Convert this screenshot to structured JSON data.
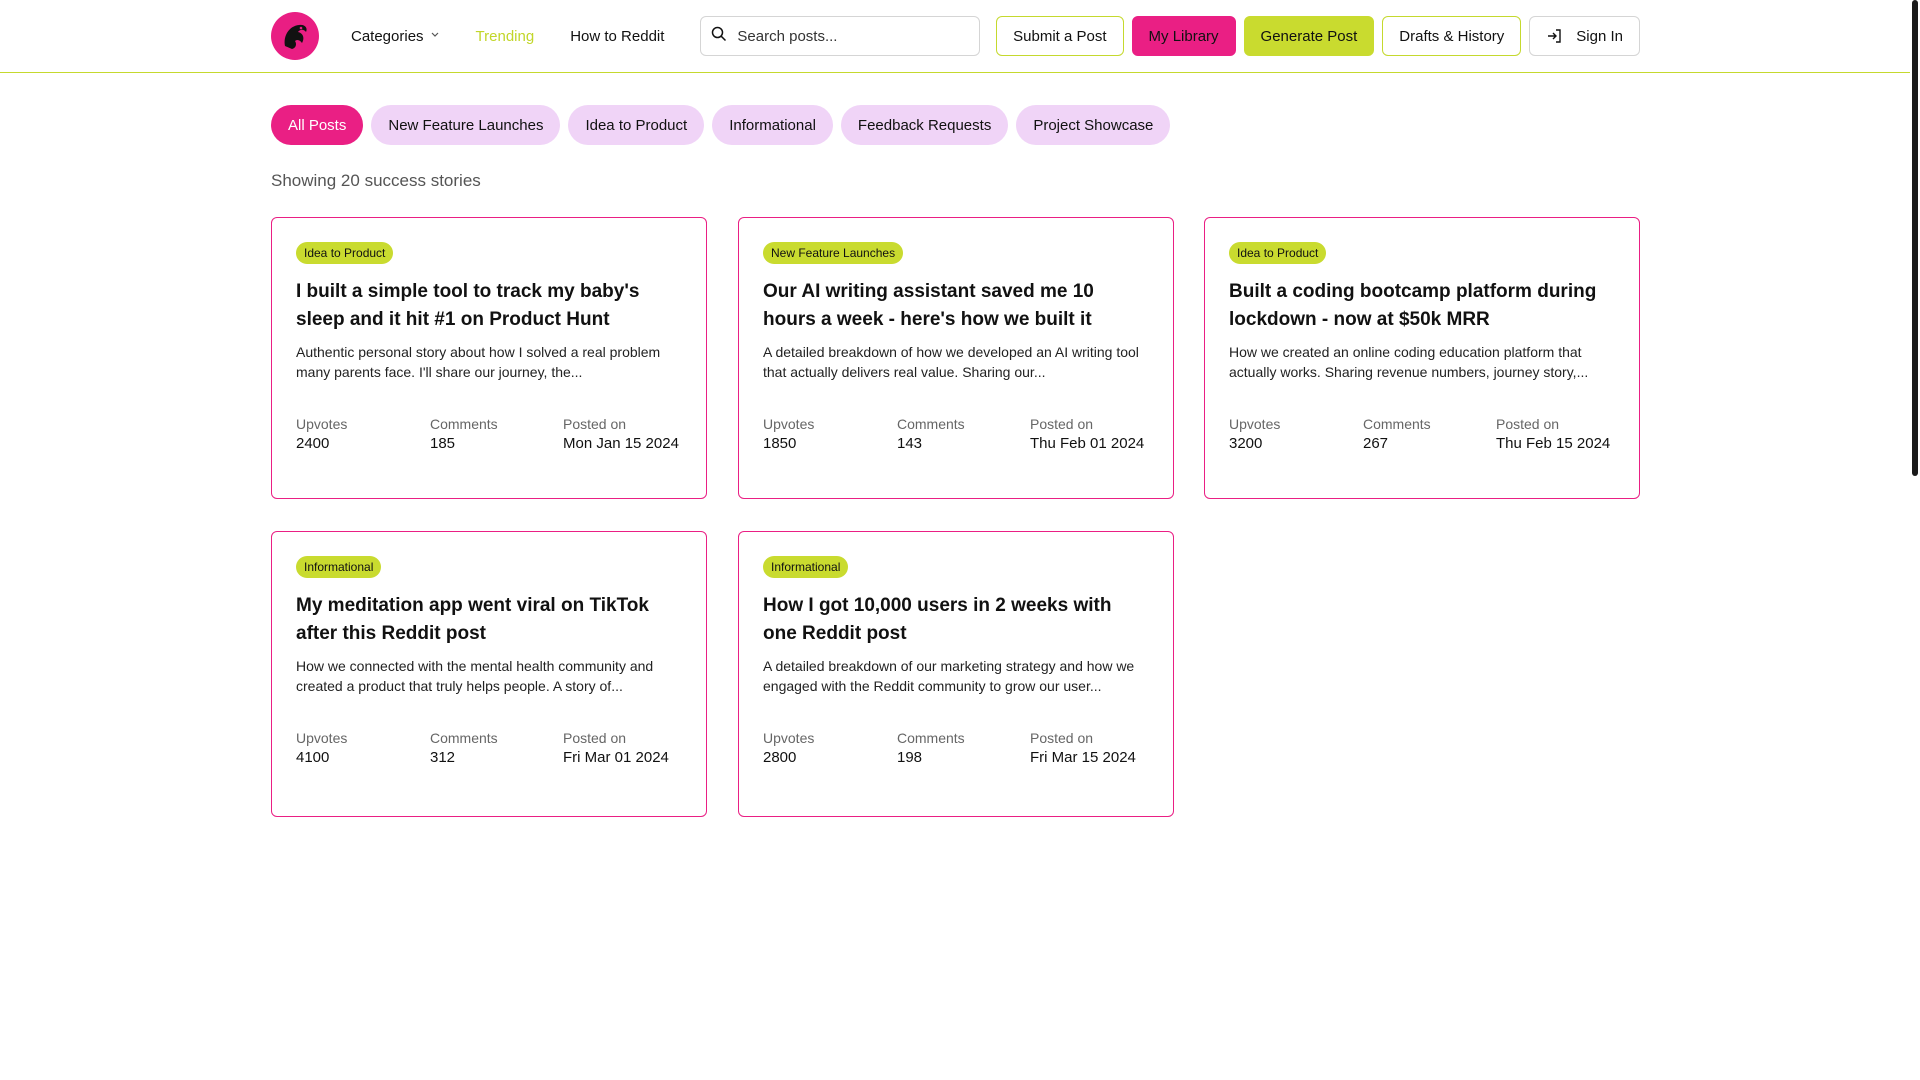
{
  "header": {
    "nav": {
      "categories": "Categories",
      "trending": "Trending",
      "how_to": "How to Reddit"
    },
    "search": {
      "placeholder": "Search posts..."
    },
    "buttons": {
      "submit": "Submit a Post",
      "library": "My Library",
      "generate": "Generate Post",
      "drafts": "Drafts & History",
      "signin": "Sign In"
    }
  },
  "filters": [
    "All Posts",
    "New Feature Launches",
    "Idea to Product",
    "Informational",
    "Feedback Requests",
    "Project Showcase"
  ],
  "active_filter": "All Posts",
  "count_text": "Showing 20 success stories",
  "stat_labels": {
    "upvotes": "Upvotes",
    "comments": "Comments",
    "posted": "Posted on"
  },
  "posts": [
    {
      "category": "Idea to Product",
      "title": "I built a simple tool to track my baby's sleep and it hit #1 on Product Hunt",
      "description": "Authentic personal story about how I solved a real problem many parents face. I'll share our journey, the...",
      "upvotes": "2400",
      "comments": "185",
      "posted": "Mon Jan 15 2024"
    },
    {
      "category": "New Feature Launches",
      "title": "Our AI writing assistant saved me 10 hours a week - here's how we built it",
      "description": "A detailed breakdown of how we developed an AI writing tool that actually delivers real value. Sharing our...",
      "upvotes": "1850",
      "comments": "143",
      "posted": "Thu Feb 01 2024"
    },
    {
      "category": "Idea to Product",
      "title": "Built a coding bootcamp platform during lockdown - now at $50k MRR",
      "description": "How we created an online coding education platform that actually works. Sharing revenue numbers, journey story,...",
      "upvotes": "3200",
      "comments": "267",
      "posted": "Thu Feb 15 2024"
    },
    {
      "category": "Informational",
      "title": "My meditation app went viral on TikTok after this Reddit post",
      "description": "How we connected with the mental health community and created a product that truly helps people. A story of...",
      "upvotes": "4100",
      "comments": "312",
      "posted": "Fri Mar 01 2024"
    },
    {
      "category": "Informational",
      "title": "How I got 10,000 users in 2 weeks with one Reddit post",
      "description": "A detailed breakdown of our marketing strategy and how we engaged with the Reddit community to grow our user...",
      "upvotes": "2800",
      "comments": "198",
      "posted": "Fri Mar 15 2024"
    }
  ],
  "colors": {
    "brand_pink": "#ea1f84",
    "brand_lime": "#c9db2f",
    "pill_bg": "#f0d4f7"
  },
  "icons": {
    "logo": "bird-logo-icon",
    "search": "search-icon",
    "chevron": "chevron-down-icon",
    "signin": "sign-in-icon"
  }
}
